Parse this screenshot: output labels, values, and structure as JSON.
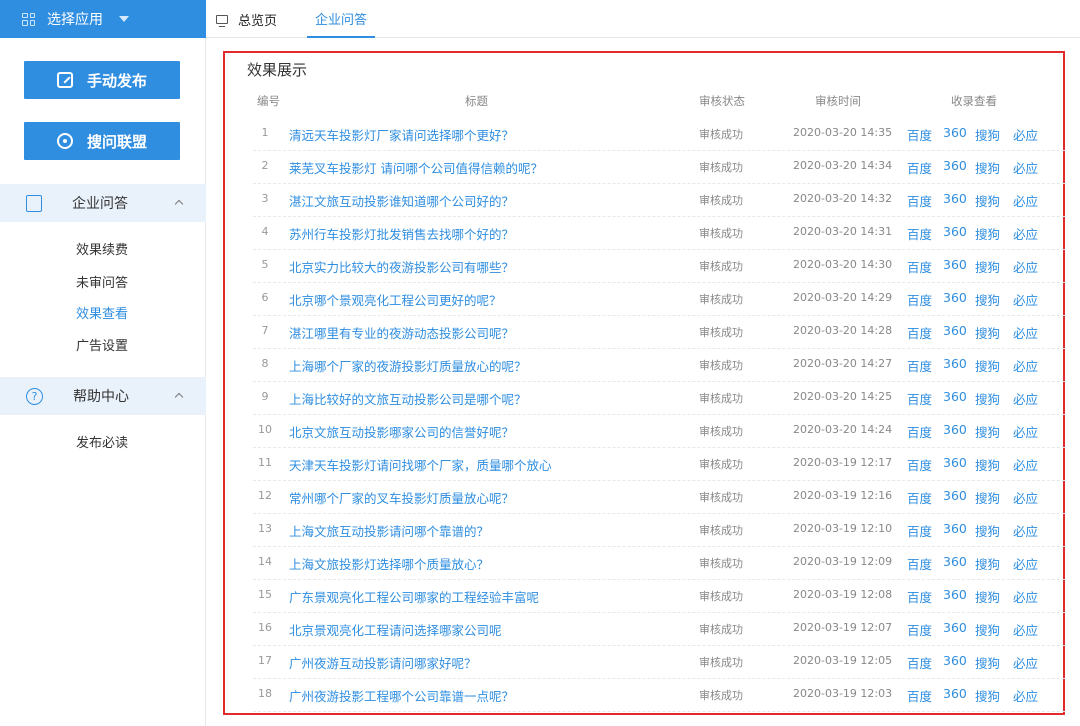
{
  "topbar": {
    "app_select_label": "选择应用",
    "tabs": [
      {
        "label": "总览页"
      },
      {
        "label": "企业问答"
      }
    ]
  },
  "sidebar": {
    "publish_button": "手动发布",
    "alliance_button": "搜问联盟",
    "group1": {
      "label": "企业问答",
      "items": [
        "效果续费",
        "未审问答",
        "效果查看",
        "广告设置"
      ]
    },
    "group2": {
      "label": "帮助中心",
      "items": [
        "发布必读"
      ]
    }
  },
  "panel": {
    "title": "效果展示",
    "columns": {
      "num": "编号",
      "title": "标题",
      "status": "审核状态",
      "time": "审核时间",
      "engines": "收录查看"
    },
    "engines": [
      "百度",
      "360",
      "搜狗",
      "必应"
    ],
    "rows": [
      {
        "num": "1",
        "title": "清远天车投影灯厂家请问选择哪个更好？",
        "status": "审核成功",
        "time": "2020-03-20 14:35"
      },
      {
        "num": "2",
        "title": "莱芜叉车投影灯 请问哪个公司值得信赖的呢？",
        "status": "审核成功",
        "time": "2020-03-20 14:34"
      },
      {
        "num": "3",
        "title": "湛江文旅互动投影谁知道哪个公司好的？",
        "status": "审核成功",
        "time": "2020-03-20 14:32"
      },
      {
        "num": "4",
        "title": "苏州行车投影灯批发销售去找哪个好的？",
        "status": "审核成功",
        "time": "2020-03-20 14:31"
      },
      {
        "num": "5",
        "title": "北京实力比较大的夜游投影公司有哪些？",
        "status": "审核成功",
        "time": "2020-03-20 14:30"
      },
      {
        "num": "6",
        "title": "北京哪个景观亮化工程公司更好的呢？",
        "status": "审核成功",
        "time": "2020-03-20 14:29"
      },
      {
        "num": "7",
        "title": "湛江哪里有专业的夜游动态投影公司呢？",
        "status": "审核成功",
        "time": "2020-03-20 14:28"
      },
      {
        "num": "8",
        "title": "上海哪个厂家的夜游投影灯质量放心的呢？",
        "status": "审核成功",
        "time": "2020-03-20 14:27"
      },
      {
        "num": "9",
        "title": "上海比较好的文旅互动投影公司是哪个呢？",
        "status": "审核成功",
        "time": "2020-03-20 14:25"
      },
      {
        "num": "10",
        "title": "北京文旅互动投影哪家公司的信誉好呢？",
        "status": "审核成功",
        "time": "2020-03-20 14:24"
      },
      {
        "num": "11",
        "title": "天津天车投影灯请问找哪个厂家，质量哪个放心",
        "status": "审核成功",
        "time": "2020-03-19 12:17"
      },
      {
        "num": "12",
        "title": "常州哪个厂家的叉车投影灯质量放心呢？",
        "status": "审核成功",
        "time": "2020-03-19 12:16"
      },
      {
        "num": "13",
        "title": "上海文旅互动投影请问哪个靠谱的？",
        "status": "审核成功",
        "time": "2020-03-19 12:10"
      },
      {
        "num": "14",
        "title": "上海文旅投影灯选择哪个质量放心？",
        "status": "审核成功",
        "time": "2020-03-19 12:09"
      },
      {
        "num": "15",
        "title": "广东景观亮化工程公司哪家的工程经验丰富呢",
        "status": "审核成功",
        "time": "2020-03-19 12:08"
      },
      {
        "num": "16",
        "title": "北京景观亮化工程请问选择哪家公司呢",
        "status": "审核成功",
        "time": "2020-03-19 12:07"
      },
      {
        "num": "17",
        "title": "广州夜游互动投影请问哪家好呢？",
        "status": "审核成功",
        "time": "2020-03-19 12:05"
      },
      {
        "num": "18",
        "title": "广州夜游投影工程哪个公司靠谱一点呢？",
        "status": "审核成功",
        "time": "2020-03-19 12:03"
      }
    ]
  }
}
